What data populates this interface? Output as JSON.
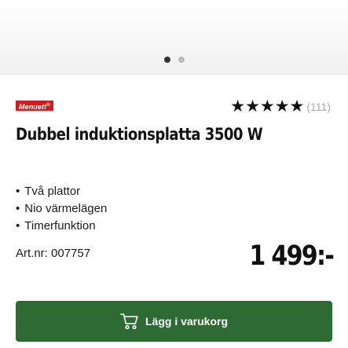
{
  "gallery": {
    "dot_count": 2,
    "active_index": 0
  },
  "product": {
    "brand": "Menuett",
    "brand_mark": "®",
    "rating_stars": "★★★★★",
    "rating": 5,
    "review_count": "(111)",
    "title": "Dubbel induktionsplatta 3500 W",
    "features": [
      "Två plattor",
      "Nio värmelägen",
      "Timerfunktion"
    ],
    "article_number": "Art.nr: 007757",
    "price": "1 499:-"
  },
  "cart_button": {
    "label": "Lägg i varukorg",
    "icon": "cart-icon"
  },
  "colors": {
    "brand_red": "#cf1d1d",
    "button_green": "#2e6a33",
    "count_gray": "#a9a9a9"
  }
}
